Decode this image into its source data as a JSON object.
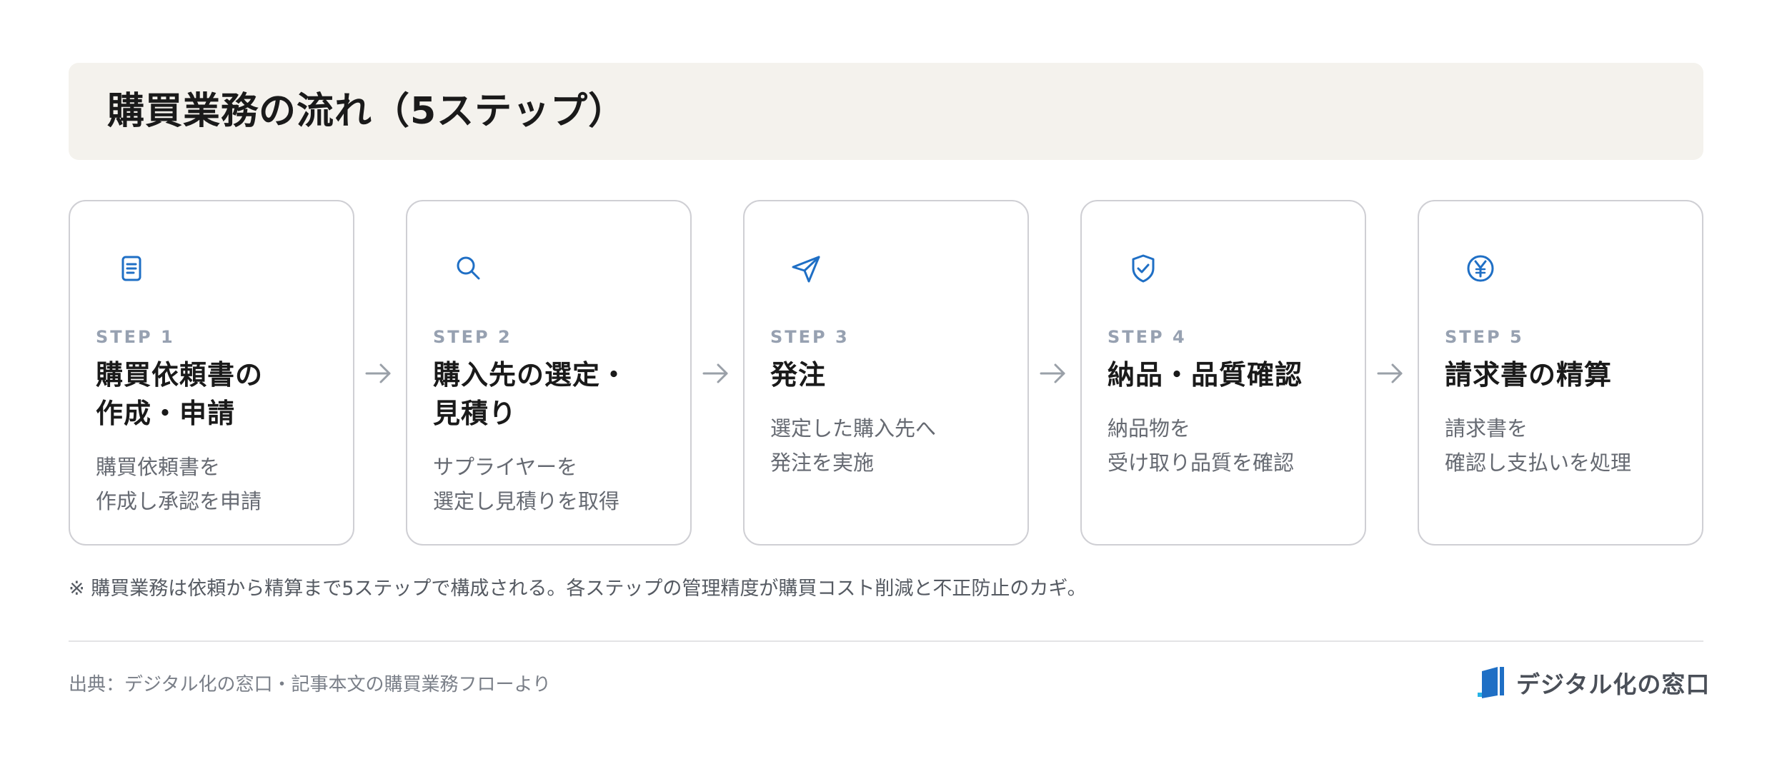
{
  "header": {
    "title": "購買業務の流れ（5ステップ）"
  },
  "steps": [
    {
      "label": "STEP 1",
      "title": "購買依頼書の\n作成・申請",
      "desc": "購買依頼書を\n作成し承認を申請",
      "icon": "document-icon"
    },
    {
      "label": "STEP 2",
      "title": "購入先の選定・\n見積り",
      "desc": "サプライヤーを\n選定し見積りを取得",
      "icon": "search-icon"
    },
    {
      "label": "STEP 3",
      "title": "発注",
      "desc": "選定した購入先へ\n発注を実施",
      "icon": "send-icon"
    },
    {
      "label": "STEP 4",
      "title": "納品・品質確認",
      "desc": "納品物を\n受け取り品質を確認",
      "icon": "shield-check-icon"
    },
    {
      "label": "STEP 5",
      "title": "請求書の精算",
      "desc": "請求書を\n確認し支払いを処理",
      "icon": "yen-icon"
    }
  ],
  "note": "※ 購買業務は依頼から精算まで5ステップで構成される。各ステップの管理精度が購買コスト削減と不正防止のカギ。",
  "footer": {
    "source": "出典：デジタル化の窓口・記事本文の購買業務フローより",
    "logo_text": "デジタル化の窓口"
  },
  "colors": {
    "accent": "#1f6fc5",
    "step_label": "#97a1b1",
    "title_band": "#f4f2ed"
  }
}
